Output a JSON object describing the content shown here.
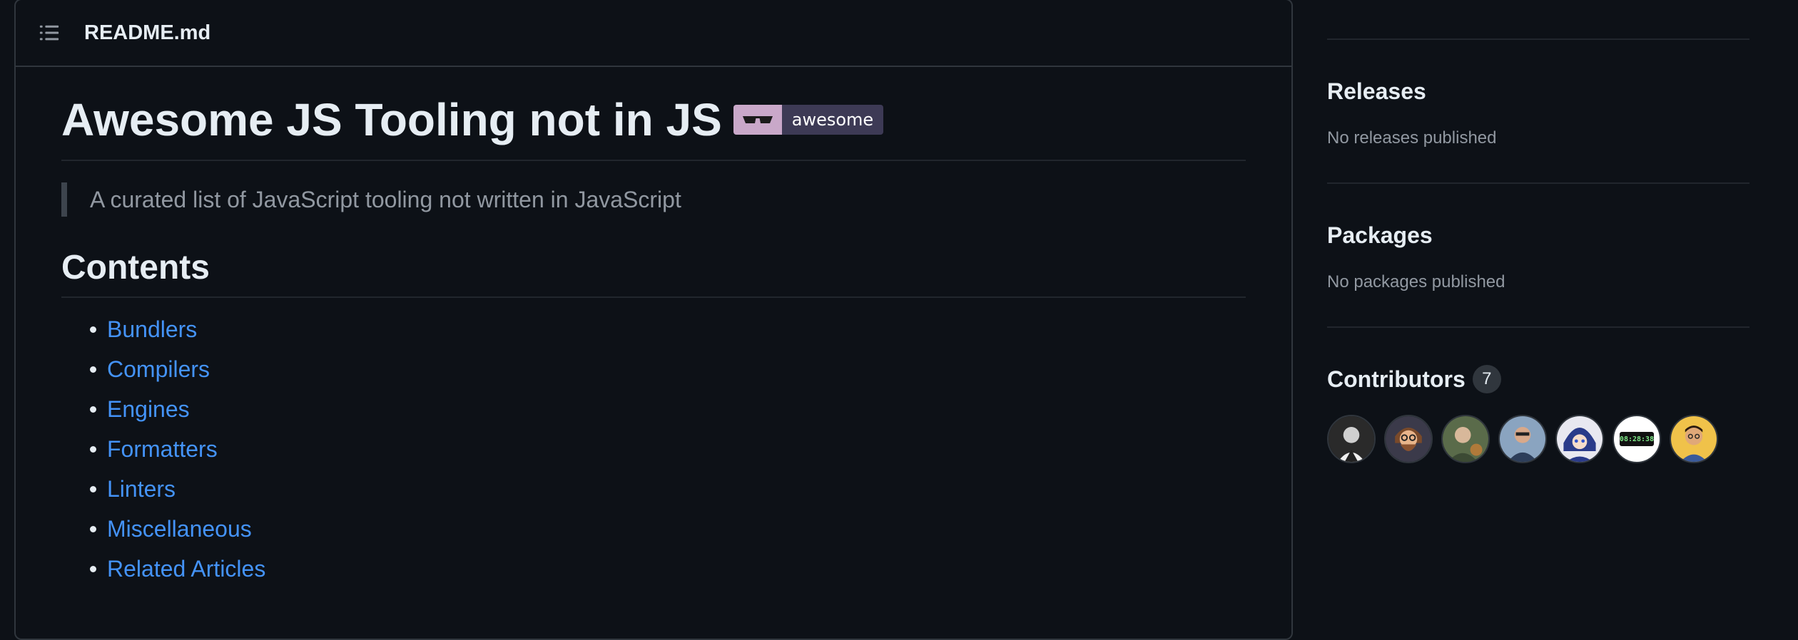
{
  "readme": {
    "filename": "README.md",
    "title": "Awesome JS Tooling not in JS",
    "badge_label": "awesome",
    "description": "A curated list of JavaScript tooling not written in JavaScript",
    "contents_heading": "Contents",
    "toc": [
      "Bundlers",
      "Compilers",
      "Engines",
      "Formatters",
      "Linters",
      "Miscellaneous",
      "Related Articles"
    ]
  },
  "sidebar": {
    "releases": {
      "title": "Releases",
      "text": "No releases published"
    },
    "packages": {
      "title": "Packages",
      "text": "No packages published"
    },
    "contributors": {
      "title": "Contributors",
      "count": "7",
      "clock_avatar_text": "08:28:38"
    }
  },
  "colors": {
    "background": "#0d1117",
    "link": "#4493f8",
    "border": "#30363d",
    "muted_text": "#9198a1"
  },
  "icons": [
    "list-icon",
    "sunglasses-icon"
  ]
}
